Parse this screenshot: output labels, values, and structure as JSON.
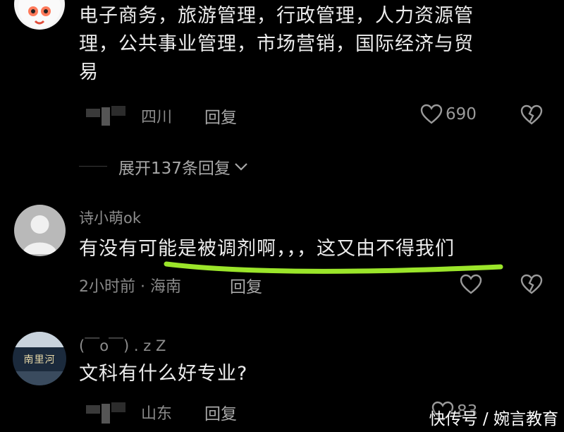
{
  "comments": [
    {
      "text_lines": [
        "电子商务，旅游管理，行政管理，人力资源管",
        "理，公共事业管理，市场营销，国际经济与贸",
        "易"
      ],
      "location": "四川",
      "reply_label": "回复",
      "likes": "690",
      "expand_label": "展开137条回复"
    },
    {
      "username": "诗小萌ok",
      "text": "有没有可能是被调剂啊，，，这又由不得我们",
      "meta": "2小时前 · 海南",
      "reply_label": "回复"
    },
    {
      "username": "(￣o￣) . z Z",
      "avatar_text": "南里河",
      "text": "文科有什么好专业?",
      "location": "山东",
      "reply_label": "回复",
      "likes": "83"
    }
  ],
  "watermark": "快传号 / 婉言教育",
  "colors": {
    "background": "#000000",
    "underline": "#9be52a",
    "muted": "#8a8a8a"
  }
}
